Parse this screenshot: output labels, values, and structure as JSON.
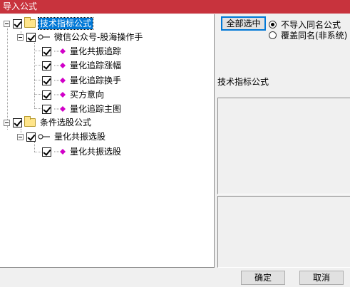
{
  "window": {
    "title": "导入公式"
  },
  "tree": {
    "root1": {
      "label": "技术指标公式"
    },
    "group1": {
      "label": "微信公众号-股海操作手"
    },
    "items1": [
      {
        "label": "量化共振追踪"
      },
      {
        "label": "量化追踪涨幅"
      },
      {
        "label": "量化追踪换手"
      },
      {
        "label": "买方意向"
      },
      {
        "label": "量化追踪主图"
      }
    ],
    "root2": {
      "label": "条件选股公式"
    },
    "group2": {
      "label": "量化共振选股"
    },
    "items2": [
      {
        "label": "量化共振选股"
      }
    ]
  },
  "options": {
    "select_all_label": "全部选中",
    "radio_no_import": "不导入同名公式",
    "radio_overwrite": "覆盖同名(非系统)"
  },
  "description": {
    "label": "技术指标公式"
  },
  "footer": {
    "ok_label": "确定",
    "cancel_label": "取消"
  },
  "colors": {
    "title_bar": "#c8333d",
    "selection": "#0078d7",
    "leaf_icon": "#d100c8"
  }
}
